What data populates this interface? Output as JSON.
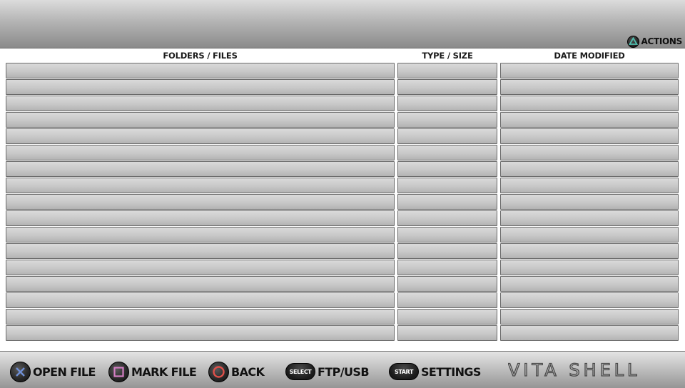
{
  "header": {
    "actions_label": "ACTIONS",
    "actions_icon": "triangle-button-icon"
  },
  "columns": {
    "name_header": "FOLDERS / FILES",
    "type_header": "TYPE / SIZE",
    "date_header": "DATE MODIFIED"
  },
  "rows_count": 17,
  "footer": {
    "open_file_label": "OPEN FILE",
    "mark_file_label": "MARK FILE",
    "back_label": "BACK",
    "select_button_text": "SELECT",
    "ftp_usb_label": "FTP/USB",
    "start_button_text": "START",
    "settings_label": "SETTINGS",
    "logo_text": "VITA SHELL"
  },
  "colors": {
    "cross": "#5b7fc4",
    "square": "#d47fc4",
    "circle": "#e0504a",
    "triangle": "#4fbfae"
  }
}
